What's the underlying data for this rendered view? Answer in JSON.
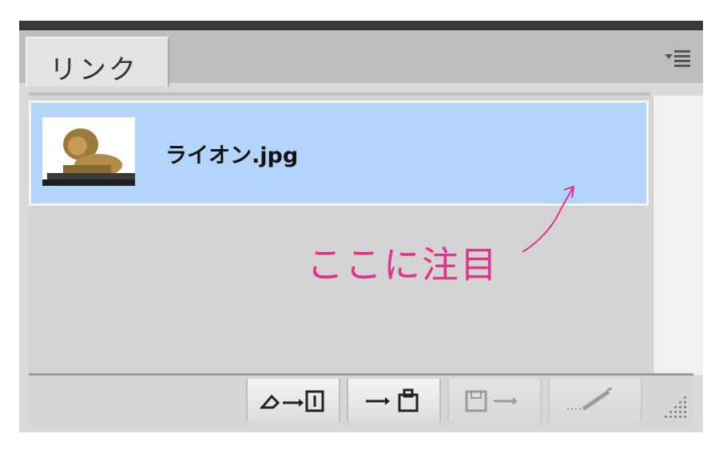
{
  "panel": {
    "tab_label": "リンク",
    "menu_icon": "panel-menu-icon"
  },
  "links": [
    {
      "file_name": "ライオン.jpg",
      "thumbnail": "lion-image",
      "selected": true
    }
  ],
  "toolbar": [
    {
      "name": "relink-from-cc-button",
      "icon": "relink-icon",
      "enabled": true
    },
    {
      "name": "goto-link-button",
      "icon": "goto-link-icon",
      "enabled": true
    },
    {
      "name": "update-link-button",
      "icon": "update-link-icon",
      "enabled": false
    },
    {
      "name": "edit-original-button",
      "icon": "edit-original-pencil-icon",
      "enabled": false
    }
  ],
  "annotation": {
    "text": "ここに注目",
    "color": "#e0338a"
  },
  "colors": {
    "selection": "#b3d4fb",
    "panel_bg": "#d9d9d9"
  }
}
